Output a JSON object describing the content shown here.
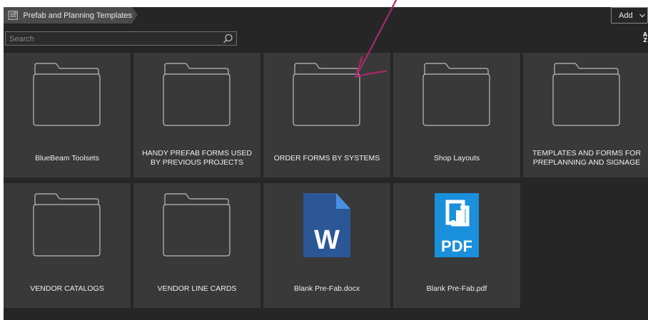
{
  "breadcrumb": {
    "label": "Prefab and Planning Templates",
    "icon": "template-icon"
  },
  "toolbar": {
    "add_label": "Add",
    "sort_label_top": "A",
    "sort_label_bottom": "Z"
  },
  "search": {
    "placeholder": "Search",
    "value": ""
  },
  "items": [
    {
      "label": "BlueBeam Toolsets",
      "kind": "folder"
    },
    {
      "label": "HANDY PREFAB FORMS USED BY PREVIOUS PROJECTS",
      "kind": "folder"
    },
    {
      "label": "ORDER FORMS BY SYSTEMS",
      "kind": "folder"
    },
    {
      "label": "Shop Layouts",
      "kind": "folder"
    },
    {
      "label": "TEMPLATES AND FORMS FOR PREPLANNING AND SIGNAGE",
      "kind": "folder"
    },
    {
      "label": "VENDOR CATALOGS",
      "kind": "folder"
    },
    {
      "label": "VENDOR LINE CARDS",
      "kind": "folder"
    },
    {
      "label": "Blank Pre-Fab.docx",
      "kind": "word",
      "icon_text": "W"
    },
    {
      "label": "Blank Pre-Fab.pdf",
      "kind": "pdf",
      "icon_text": "PDF"
    }
  ],
  "colors": {
    "app_bg": "#262626",
    "tile_bg": "#393939",
    "word_blue": "#2b5797",
    "pdf_blue": "#1a8fdc",
    "annotation": "#a8286e"
  }
}
